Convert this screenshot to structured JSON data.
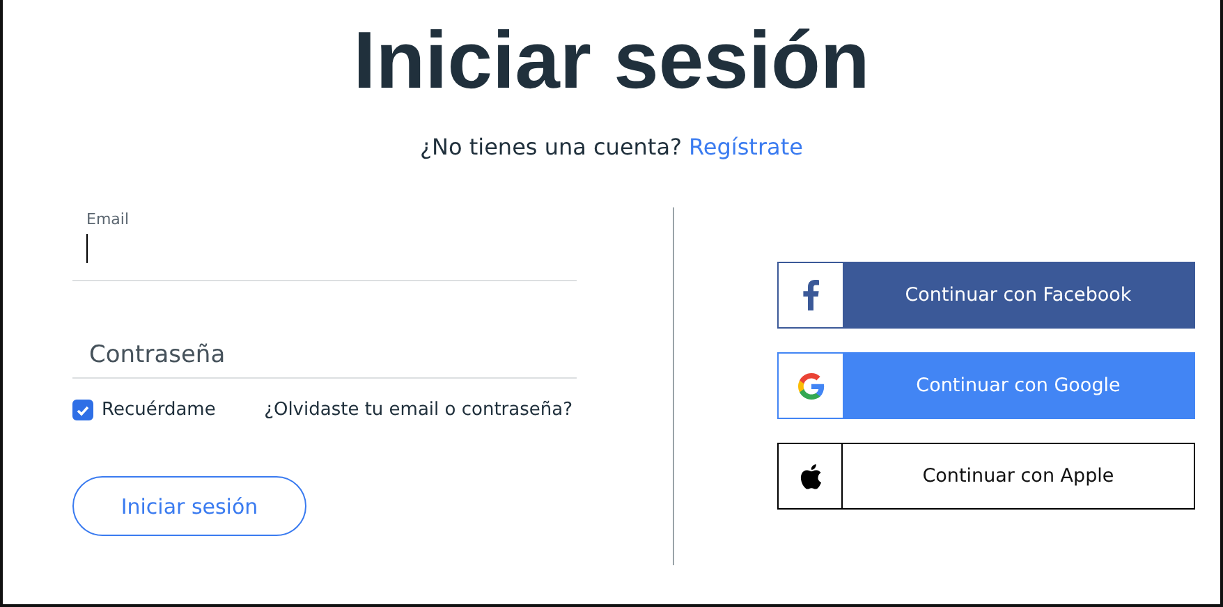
{
  "title": "Iniciar sesión",
  "signup": {
    "question": "¿No tienes una cuenta?",
    "link": "Regístrate"
  },
  "email": {
    "label": "Email",
    "focused": true
  },
  "password": {
    "placeholder": "Contraseña"
  },
  "remember": {
    "label": "Recuérdame",
    "checked": true
  },
  "forgot": "¿Olvidaste tu email o contraseña?",
  "submit": "Iniciar sesión",
  "social": [
    {
      "kind": "facebook",
      "label": "Continuar con Facebook"
    },
    {
      "kind": "google",
      "label": "Continuar con Google"
    },
    {
      "kind": "apple",
      "label": "Continuar con Apple"
    }
  ]
}
